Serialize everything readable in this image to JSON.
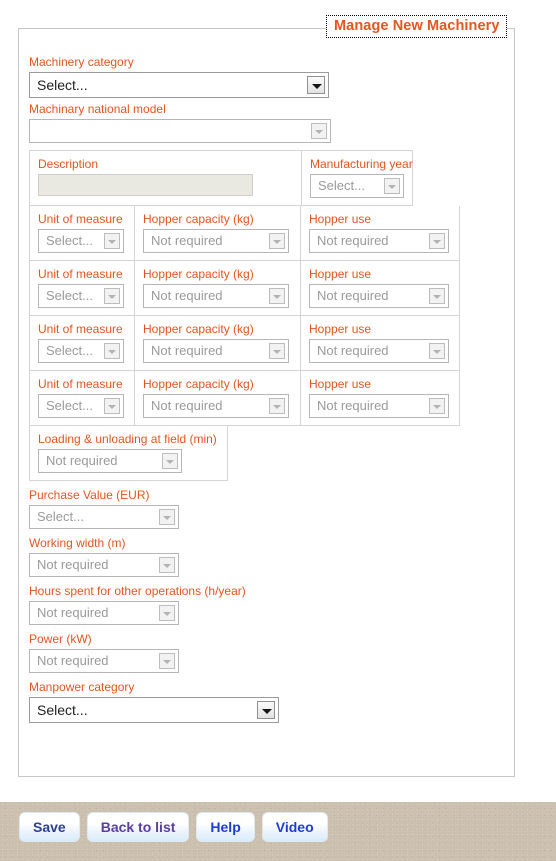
{
  "form": {
    "legend": "Manage New Machinery",
    "machinery_category": {
      "label": "Machinery category",
      "value": "Select..."
    },
    "machinary_national_model": {
      "label": "Machinary national model",
      "value": ""
    },
    "description": {
      "label": "Description",
      "value": ""
    },
    "manufacturing_year": {
      "label": "Manufacturing year",
      "value": "Select..."
    },
    "hopper_rows": [
      {
        "unit_label": "Unit of measure",
        "unit_value": "Select...",
        "capacity_label": "Hopper capacity (kg)",
        "capacity_value": "Not required",
        "use_label": "Hopper use",
        "use_value": "Not required"
      },
      {
        "unit_label": "Unit of measure",
        "unit_value": "Select...",
        "capacity_label": "Hopper capacity (kg)",
        "capacity_value": "Not required",
        "use_label": "Hopper use",
        "use_value": "Not required"
      },
      {
        "unit_label": "Unit of measure",
        "unit_value": "Select...",
        "capacity_label": "Hopper capacity (kg)",
        "capacity_value": "Not required",
        "use_label": "Hopper use",
        "use_value": "Not required"
      },
      {
        "unit_label": "Unit of measure",
        "unit_value": "Select...",
        "capacity_label": "Hopper capacity (kg)",
        "capacity_value": "Not required",
        "use_label": "Hopper use",
        "use_value": "Not required"
      }
    ],
    "loading_unloading": {
      "label": "Loading & unloading at field (min)",
      "value": "Not required"
    },
    "purchase_value": {
      "label": "Purchase Value (EUR)",
      "value": "Select..."
    },
    "working_width": {
      "label": "Working width (m)",
      "value": "Not required"
    },
    "hours_other_operations": {
      "label": "Hours spent for other operations (h/year)",
      "value": "Not required"
    },
    "power": {
      "label": "Power (kW)",
      "value": "Not required"
    },
    "manpower_category": {
      "label": "Manpower category",
      "value": "Select..."
    }
  },
  "footer": {
    "save": "Save",
    "back_to_list": "Back to list",
    "help": "Help",
    "video": "Video"
  },
  "colors": {
    "label": "#e4551f",
    "legend": "#e4551f",
    "footer_bg": "#cbbfae",
    "button_text": "#2a2f8f"
  }
}
